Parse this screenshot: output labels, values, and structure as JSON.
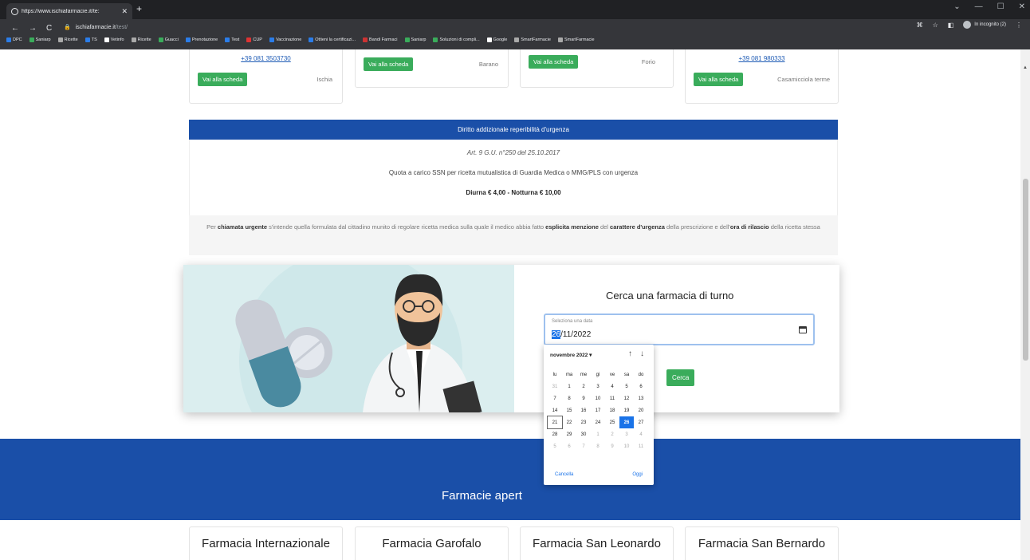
{
  "browser": {
    "tab_title": "https://www.ischiafarmacie.it/te:",
    "url_domain": "ischiafarmacie.it",
    "url_path": "/test/",
    "incognito_label": "In incognito (2)",
    "bookmarks": [
      "DPC",
      "Saniarp",
      "Ricette",
      "TS",
      "Vetinfo",
      "Ricette",
      "Guacci",
      "Prenotazione",
      "Test",
      "CUP",
      "Vaccinazione",
      "Ottieni la certificazi...",
      "Bandi Farmaci",
      "Saniarp",
      "Soluzioni di compli...",
      "Google",
      "SmartFarmacie",
      "SmartFarmacie"
    ]
  },
  "top_cards": [
    {
      "phone": "+39 081 3503730",
      "button": "Vai alla scheda",
      "town": "Ischia"
    },
    {
      "phone": "",
      "button": "Vai alla scheda",
      "town": "Barano"
    },
    {
      "phone": "",
      "button": "Vai alla scheda",
      "town": "Forio"
    },
    {
      "phone": "+39 081 980333",
      "button": "Vai alla scheda",
      "town": "Casamicciola terme"
    }
  ],
  "urgency": {
    "title": "Diritto addizionale reperibilità d'urgenza",
    "article": "Art. 9 G.U. n°250 del 25.10.2017",
    "quota": "Quota a carico SSN per ricetta mutualistica di Guardia Medica o MMG/PLS con urgenza",
    "fee": "Diurna € 4,00 - Notturna € 10,00",
    "note_1": "Per ",
    "note_2": "chiamata urgente",
    "note_3": " s'intende quella formulata dal cittadino munito di regolare ricetta medica sulla quale il medico abbia fatto ",
    "note_4": "esplicita menzione",
    "note_5": " del ",
    "note_6": "carattere d'urgenza",
    "note_7": " della prescrizione e dell'",
    "note_8": "ora di rilascio",
    "note_9": " della ricetta stessa"
  },
  "search": {
    "title": "Cerca una farmacia di turno",
    "date_label": "Seleziona una data",
    "date_day": "26",
    "date_rest": "/11/2022",
    "button": "Cerca"
  },
  "picker": {
    "month": "novembre 2022 ▾",
    "weekdays": [
      "lu",
      "ma",
      "me",
      "gi",
      "ve",
      "sa",
      "do"
    ],
    "weeks": [
      [
        "31",
        "1",
        "2",
        "3",
        "4",
        "5",
        "6"
      ],
      [
        "7",
        "8",
        "9",
        "10",
        "11",
        "12",
        "13"
      ],
      [
        "14",
        "15",
        "16",
        "17",
        "18",
        "19",
        "20"
      ],
      [
        "21",
        "22",
        "23",
        "24",
        "25",
        "26",
        "27"
      ],
      [
        "28",
        "29",
        "30",
        "1",
        "2",
        "3",
        "4"
      ],
      [
        "5",
        "6",
        "7",
        "8",
        "9",
        "10",
        "11"
      ]
    ],
    "cancel": "Cancella",
    "today": "Oggi"
  },
  "banner": {
    "text": "Farmacie apert"
  },
  "bottom_cards": [
    {
      "name": "Farmacia Internazionale"
    },
    {
      "name": "Farmacia Garofalo"
    },
    {
      "name": "Farmacia San Leonardo"
    },
    {
      "name": "Farmacia San Bernardo"
    }
  ],
  "colors": {
    "primary_blue": "#1a4fa8",
    "button_green": "#3aac5b",
    "selected_date": "#1a73e8"
  }
}
